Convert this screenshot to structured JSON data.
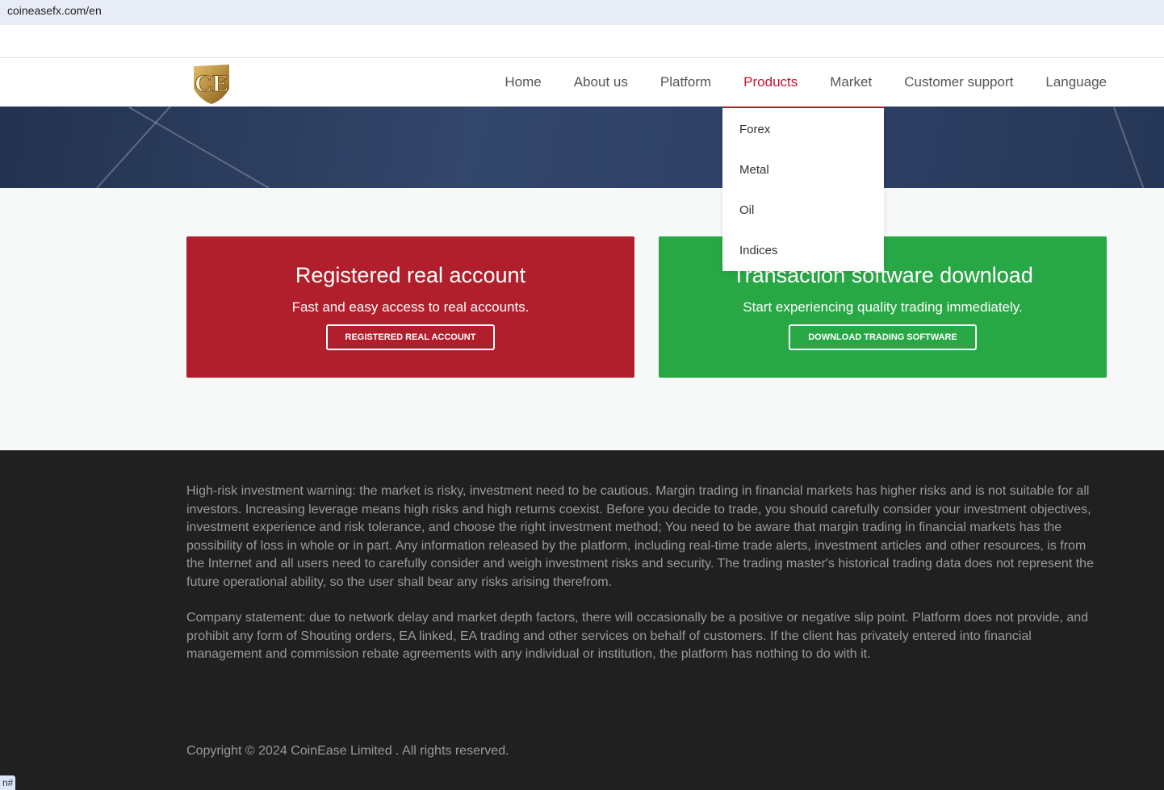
{
  "browser": {
    "url": "coineasefx.com/en",
    "status": "n#"
  },
  "header": {
    "logo_text": "CE",
    "nav": [
      "Home",
      "About us",
      "Platform",
      "Products",
      "Market",
      "Customer support",
      "Language"
    ],
    "active": "Products"
  },
  "dropdown": {
    "items": [
      "Forex",
      "Metal",
      "Oil",
      "Indices"
    ]
  },
  "cards": [
    {
      "title": "Registered real account",
      "subtitle": "Fast and easy access to real accounts.",
      "button": "REGISTERED REAL ACCOUNT",
      "color": "#b21f2c"
    },
    {
      "title": "Transaction software download",
      "subtitle": "Start experiencing quality trading immediately.",
      "button": "DOWNLOAD TRADING SOFTWARE",
      "color": "#28a745"
    }
  ],
  "footer": {
    "warning": "High-risk investment warning: the market is risky, investment need to be cautious. Margin trading in financial markets has higher risks and is not suitable for all investors. Increasing leverage means high risks and high returns coexist. Before you decide to trade, you should carefully consider your investment objectives, investment experience and risk tolerance, and choose the right investment method; You need to be aware that margin trading in financial markets has the possibility of loss in whole or in part. Any information released by the platform, including real-time trade alerts, investment articles and other resources, is from the Internet and all users need to carefully consider and weigh investment risks and security. The trading master's historical trading data does not represent the future operational ability, so the user shall bear any risks arising therefrom.",
    "statement": "Company statement: due to network delay and market depth factors, there will occasionally be a positive or negative slip point. Platform does not provide, and prohibit any form of Shouting orders, EA linked, EA trading and other services on behalf of customers. If the client has privately entered into financial management and commission rebate agreements with any individual or institution, the platform has nothing to do with it.",
    "copyright": "Copyright © 2024 CoinEase Limited . All rights reserved."
  }
}
